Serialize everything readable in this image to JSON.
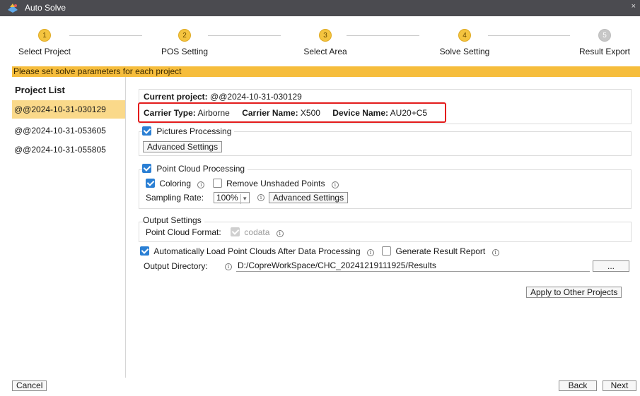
{
  "window": {
    "title": "Auto Solve",
    "close_glyph": "×"
  },
  "steps": [
    {
      "number": "1",
      "label": "Select Project",
      "state": "done"
    },
    {
      "number": "2",
      "label": "POS Setting",
      "state": "done"
    },
    {
      "number": "3",
      "label": "Select Area",
      "state": "done"
    },
    {
      "number": "4",
      "label": "Solve Setting",
      "state": "current"
    },
    {
      "number": "5",
      "label": "Result Export",
      "state": "pending"
    }
  ],
  "banner": "Please set solve parameters for each project",
  "sidebar": {
    "heading": "Project List",
    "projects": [
      {
        "name": "@@2024-10-31-030129",
        "selected": true
      },
      {
        "name": "@@2024-10-31-053605",
        "selected": false
      },
      {
        "name": "@@2024-10-31-055805",
        "selected": false
      }
    ]
  },
  "project_info": {
    "current_label": "Current project:",
    "current_value": "@@2024-10-31-030129",
    "carrier_type_label": "Carrier Type:",
    "carrier_type_value": "Airborne",
    "carrier_name_label": "Carrier Name:",
    "carrier_name_value": "X500",
    "device_name_label": "Device Name:",
    "device_name_value": "AU20+C5"
  },
  "pictures": {
    "label": "Pictures Processing",
    "checked": true,
    "advanced_label": "Advanced Settings"
  },
  "point_cloud": {
    "label": "Point Cloud Processing",
    "checked": true,
    "coloring_label": "Coloring",
    "coloring_checked": true,
    "remove_unshaded_label": "Remove Unshaded Points",
    "remove_unshaded_checked": false,
    "sampling_label": "Sampling Rate:",
    "sampling_value": "100%",
    "advanced_label": "Advanced Settings"
  },
  "output_settings": {
    "legend": "Output Settings",
    "format_label": "Point Cloud Format:",
    "format_value": "codata",
    "format_checked": true,
    "format_disabled": true
  },
  "auto_load": {
    "label": "Automatically Load Point Clouds After Data Processing",
    "checked": true
  },
  "report": {
    "label": "Generate Result Report",
    "checked": false
  },
  "output_dir": {
    "label": "Output Directory:",
    "value": "D:/CopreWorkSpace/CHC_20241219111925/Results",
    "browse_label": "..."
  },
  "apply_label": "Apply to Other Projects",
  "footer": {
    "cancel": "Cancel",
    "back": "Back",
    "next": "Next"
  },
  "colors": {
    "accent": "#f6bd3c",
    "selected_row": "#fad98a",
    "checkbox": "#2a7fd4",
    "highlight_border": "#e31b1b",
    "titlebar": "#4b4b50"
  },
  "icons": [
    "app-icon",
    "info-icon",
    "checkbox-icon",
    "dropdown-arrow-icon",
    "close-icon"
  ]
}
